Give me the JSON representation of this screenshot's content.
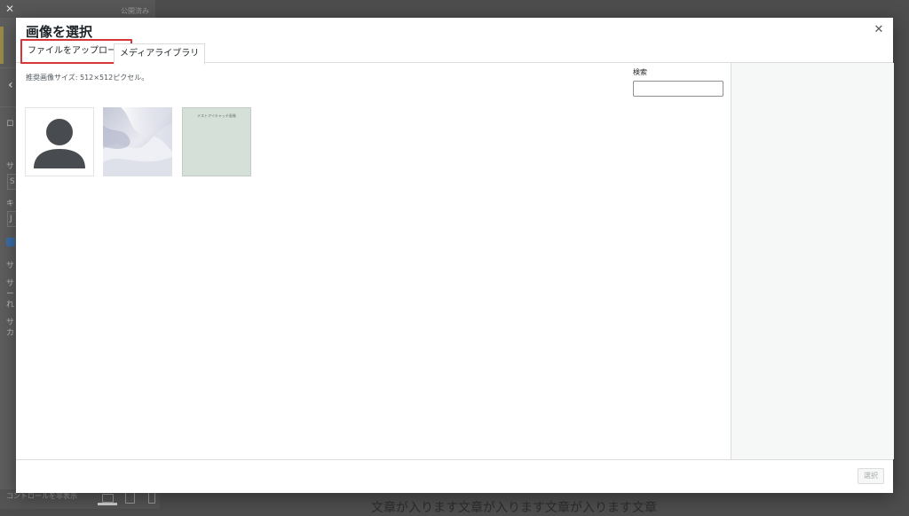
{
  "background": {
    "saved_label": "公開済み",
    "close_glyph": "✕",
    "back_glyph": "‹",
    "control_label": "コントロールを非表示",
    "preview_text": "文章が入ります文章が入ります文章が入ります文章",
    "fragments": [
      "ロ",
      "サ",
      "S",
      "キ",
      "J",
      "サ",
      "サ",
      "ー",
      "れ",
      "サ",
      "カ"
    ]
  },
  "modal": {
    "title": "画像を選択",
    "close_glyph": "✕",
    "tabs": [
      {
        "label": "ファイルをアップロード",
        "active": true,
        "highlighted": true
      },
      {
        "label": "メディアライブラリ",
        "active": false
      }
    ],
    "recommended_size": "推奨画像サイズ: 512×512ピクセル。",
    "search": {
      "label": "検索",
      "value": "",
      "placeholder": ""
    },
    "thumbnails": [
      {
        "icon": "person-avatar"
      },
      {
        "icon": "abstract-wave"
      },
      {
        "text": "テストアイキャッチ画像"
      }
    ],
    "select_button": "選択"
  },
  "colors": {
    "highlight": "#d63638",
    "overlay": "#4d4d4d",
    "avatar": "#484c50"
  }
}
